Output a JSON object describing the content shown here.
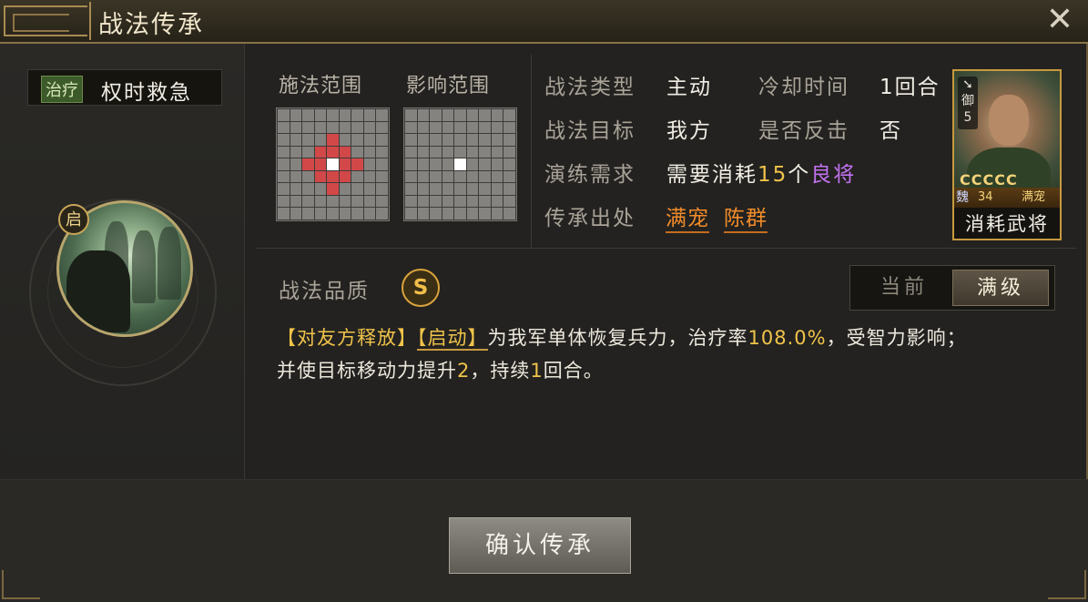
{
  "window": {
    "title": "战法传承",
    "close_icon": "close-x-icon"
  },
  "skill": {
    "tag": "治疗",
    "name": "权时救急",
    "badge": "启"
  },
  "ranges": {
    "cast_label": "施法范围",
    "effect_label": "影响范围",
    "cast_red_cells": [
      [
        2,
        4
      ],
      [
        3,
        3
      ],
      [
        3,
        4
      ],
      [
        3,
        5
      ],
      [
        4,
        2
      ],
      [
        4,
        3
      ],
      [
        4,
        5
      ],
      [
        4,
        6
      ],
      [
        5,
        3
      ],
      [
        5,
        4
      ],
      [
        5,
        5
      ],
      [
        6,
        4
      ]
    ],
    "cast_center": [
      4,
      4
    ],
    "effect_center": [
      4,
      4
    ]
  },
  "info": {
    "type_label": "战法类型",
    "type_value": "主动",
    "cooldown_label": "冷却时间",
    "cooldown_value": "1回合",
    "target_label": "战法目标",
    "target_value": "我方",
    "counter_label": "是否反击",
    "counter_value": "否",
    "practice_label": "演练需求",
    "practice_prefix": "需要消耗",
    "practice_num": "15",
    "practice_unit": "个",
    "practice_item": "良将",
    "source_label": "传承出处",
    "source_1": "满宠",
    "source_2": "陈群"
  },
  "general_card": {
    "rank_label": "御",
    "rank_num": "5",
    "stars": "CCCCC",
    "kingdom": "魏",
    "level": "34",
    "name": "满宠",
    "footer": "消耗武将"
  },
  "quality": {
    "label": "战法品质",
    "grade": "S"
  },
  "toggle": {
    "current": "当前",
    "max": "满级"
  },
  "description": {
    "part1": "【对友方释放】",
    "part2": "【启动】",
    "part3": "为我军单体恢复兵力，治疗率",
    "rate": "108.0%",
    "part4": "，受智力影响；",
    "line2a": "并使目标移动力提升",
    "move": "2",
    "line2b": "，持续",
    "turns": "1",
    "line2c": "回合。"
  },
  "confirm_button": "确认传承"
}
